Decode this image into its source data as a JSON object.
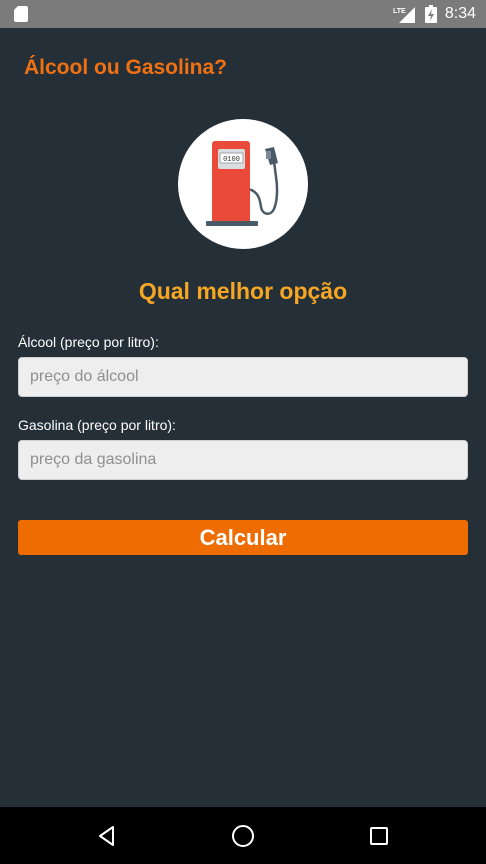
{
  "status_bar": {
    "network_label": "LTE",
    "time": "8:34"
  },
  "app": {
    "title": "Álcool ou Gasolina?",
    "subtitle": "Qual melhor opção",
    "pump_counter": "0100"
  },
  "form": {
    "alcool": {
      "label": "Álcool (preço por litro):",
      "placeholder": "preço do álcool",
      "value": ""
    },
    "gasolina": {
      "label": "Gasolina (preço por litro):",
      "placeholder": "preço da gasolina",
      "value": ""
    },
    "submit_label": "Calcular"
  },
  "colors": {
    "background": "#252f38",
    "accent_orange": "#ef6c00",
    "subtitle_yellow": "#f5a623",
    "pump_red": "#e94a3a"
  },
  "icons": {
    "status_left": "sd-card-icon",
    "status_signal": "lte-signal-icon",
    "status_battery": "battery-charging-icon",
    "logo": "fuel-pump-icon",
    "nav_back": "back-triangle-icon",
    "nav_home": "home-circle-icon",
    "nav_recent": "recent-apps-square-icon"
  }
}
